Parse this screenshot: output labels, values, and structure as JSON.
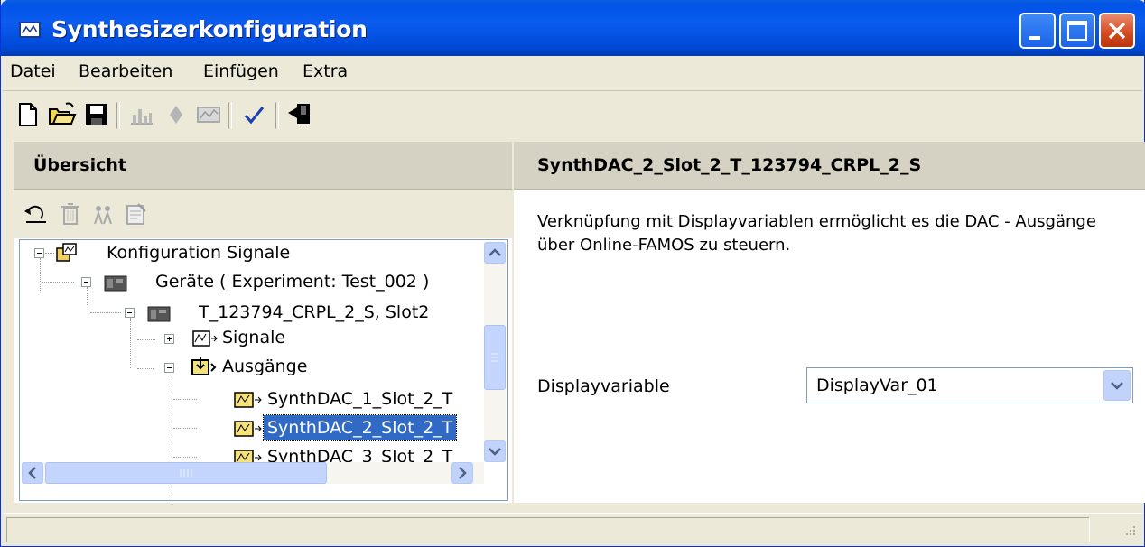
{
  "window": {
    "title": "Synthesizerkonfiguration"
  },
  "menu": [
    "Datei",
    "Bearbeiten",
    "Einfügen",
    "Extra"
  ],
  "toolbar_icons": [
    "new-file-icon",
    "open-folder-icon",
    "save-icon",
    "signal-icon",
    "diamond-icon",
    "display-icon",
    "check-icon",
    "exit-icon"
  ],
  "left": {
    "header": "Übersicht",
    "tree": {
      "root": "Konfiguration Signale",
      "devices": "Geräte ( Experiment: Test_002 )",
      "device": "T_123794_CRPL_2_S, Slot2",
      "signals": "Signale",
      "outputs": "Ausgänge",
      "out1": "SynthDAC_1_Slot_2_T",
      "out2": "SynthDAC_2_Slot_2_T",
      "out3": "SynthDAC_3_Slot_2_T"
    }
  },
  "right": {
    "header": "SynthDAC_2_Slot_2_T_123794_CRPL_2_S",
    "description": "Verknüpfung mit Displayvariablen ermöglicht es die DAC - Ausgänge über Online-FAMOS zu steuern.",
    "displayvar_label": "Displayvariable",
    "displayvar_value": "DisplayVar_01"
  }
}
